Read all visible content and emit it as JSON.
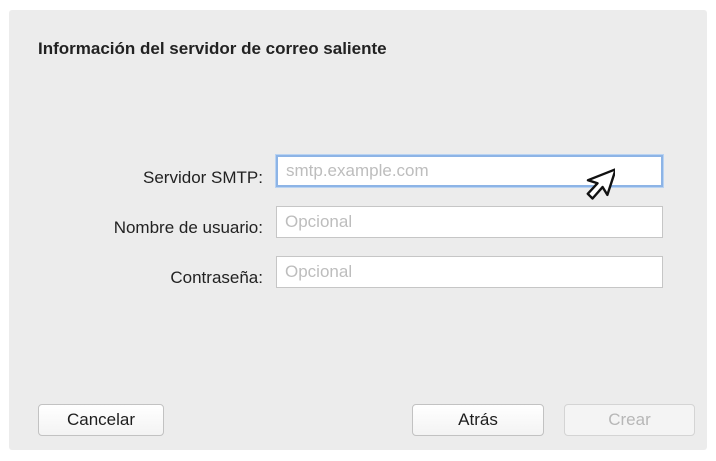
{
  "dialog": {
    "title": "Información del servidor de correo saliente"
  },
  "form": {
    "smtp_label": "Servidor SMTP:",
    "smtp_placeholder": "smtp.example.com",
    "smtp_value": "",
    "username_label": "Nombre de usuario:",
    "username_placeholder": "Opcional",
    "username_value": "",
    "password_label": "Contraseña:",
    "password_placeholder": "Opcional",
    "password_value": ""
  },
  "buttons": {
    "cancel_label": "Cancelar",
    "back_label": "Atrás",
    "create_label": "Crear"
  },
  "colors": {
    "dialog_background": "#ececec",
    "focus_ring": "#8db4e6",
    "placeholder": "#bdbdbd"
  },
  "icons": {
    "cursor": "mouse-pointer-icon"
  }
}
